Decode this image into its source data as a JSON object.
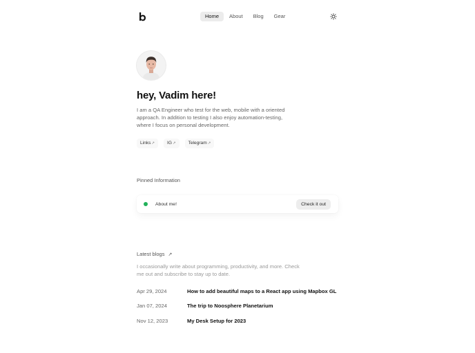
{
  "header": {
    "logo_icon": "b-logo-icon",
    "nav": [
      {
        "label": "Home",
        "active": true
      },
      {
        "label": "About",
        "active": false
      },
      {
        "label": "Blog",
        "active": false
      },
      {
        "label": "Gear",
        "active": false
      }
    ],
    "theme_icon": "sun-icon"
  },
  "profile": {
    "title": "hey, Vadim here!",
    "bio": "I am a QA Engineer who test for the web, mobile with a oriented approach. In addition to testing I also enjoy automation-testing, where I focus on personal development.",
    "links": [
      {
        "label": "Links",
        "icon": "arrow-up-right-icon"
      },
      {
        "label": "IG",
        "icon": "arrow-up-right-icon"
      },
      {
        "label": "Telegram",
        "icon": "arrow-up-right-icon"
      }
    ]
  },
  "pinned": {
    "label": "Pinned Information",
    "item_text": "About me!",
    "status_color": "#22b15a",
    "button_label": "Check it out"
  },
  "blogs": {
    "heading": "Latest blogs",
    "intro": "I occasionally write about programming, productivity, and more. Check me out and subscribe to stay up to date.",
    "posts": [
      {
        "date": "Apr 29, 2024",
        "title": "How to add beautiful maps to a React app using Mapbox GL"
      },
      {
        "date": "Jan 07, 2024",
        "title": "The trip to Noosphere Planetarium"
      },
      {
        "date": "Nov 12, 2023",
        "title": "My Desk Setup for 2023"
      }
    ]
  }
}
